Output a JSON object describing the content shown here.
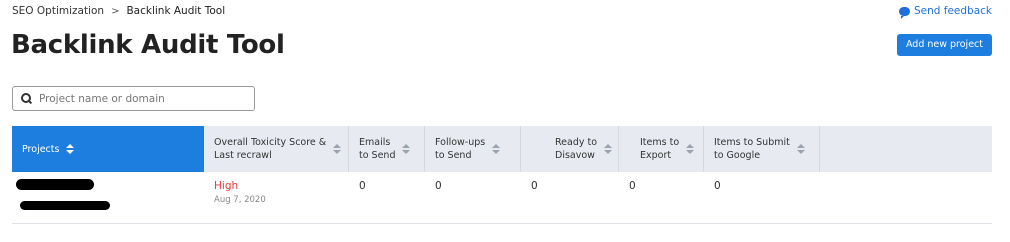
{
  "breadcrumb": {
    "parent": "SEO Optimization",
    "separator": ">",
    "current": "Backlink Audit Tool"
  },
  "feedback": {
    "label": "Send feedback",
    "icon": "chat-bubble-icon"
  },
  "page": {
    "title": "Backlink Audit Tool"
  },
  "toolbar": {
    "add_project_label": "Add new project"
  },
  "search": {
    "placeholder": "Project name or domain",
    "value": "",
    "icon": "search-icon"
  },
  "table": {
    "headers": [
      {
        "label": "Projects",
        "sortable": true,
        "active": true
      },
      {
        "label": "Overall Toxicity Score &\nLast recrawl",
        "sortable": true
      },
      {
        "label": "Emails\nto Send",
        "sortable": true
      },
      {
        "label": "Follow-ups\nto Send",
        "sortable": true
      },
      {
        "label": "Ready to\nDisavow",
        "sortable": true
      },
      {
        "label": "Items to\nExport",
        "sortable": true
      },
      {
        "label": "Items to Submit\nto Google",
        "sortable": true
      },
      {
        "label": "",
        "sortable": false
      }
    ],
    "rows": [
      {
        "project": "",
        "toxicity": "High",
        "last_recrawl": "Aug 7, 2020",
        "emails_to_send": "0",
        "followups_to_send": "0",
        "ready_to_disavow": "0",
        "items_to_export": "0",
        "items_to_submit": "0"
      }
    ]
  },
  "colors": {
    "accent": "#1e7ee0",
    "toxicity_high": "#e53935",
    "header_bg": "#e7ebf1"
  }
}
